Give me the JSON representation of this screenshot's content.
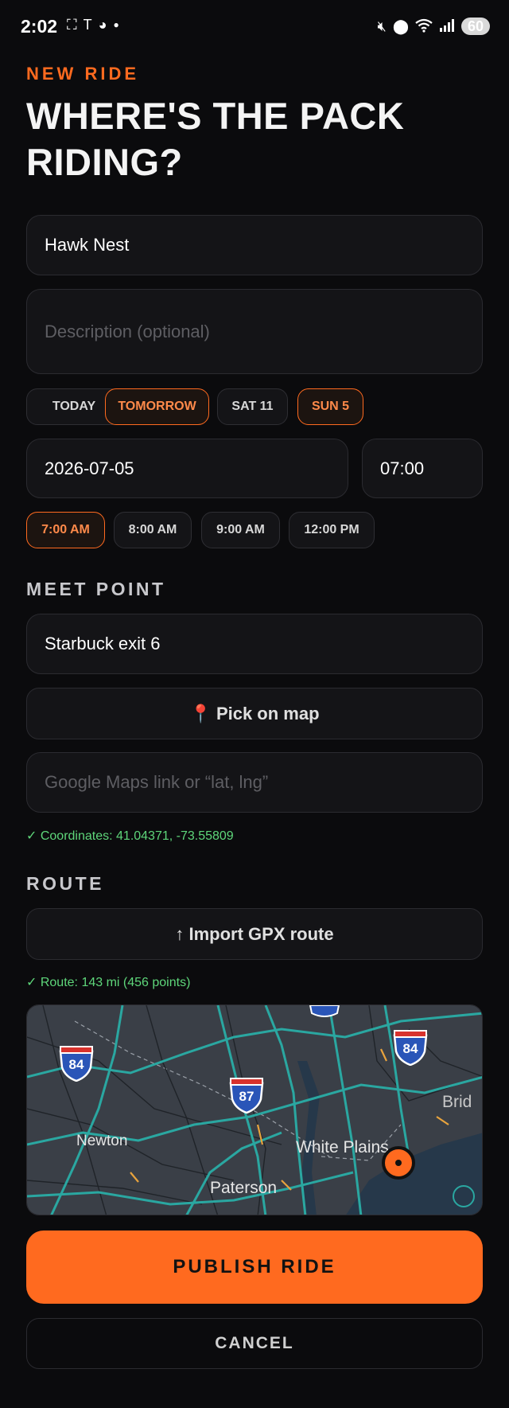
{
  "status_bar": {
    "time": "2:02",
    "left_icons": [
      "screenshot-icon",
      "tesla-icon",
      "reddit-icon",
      "dot-icon"
    ],
    "right_icons": [
      "mute-icon",
      "location-icon",
      "wifi-icon",
      "signal-icon"
    ],
    "battery": "60"
  },
  "header": {
    "eyebrow": "NEW RIDE",
    "title": "WHERE'S THE PACK RIDING?"
  },
  "form": {
    "name_value": "Hawk Nest",
    "description_placeholder": "Description (optional)",
    "date_chips": [
      {
        "label": "TODAY",
        "active": false
      },
      {
        "label": "TOMORROW",
        "active": true
      },
      {
        "label": "SAT 11",
        "active": false
      },
      {
        "label": "SUN 5",
        "active": true
      }
    ],
    "date_value": "2026-07-05",
    "time_value": "07:00",
    "time_chips": [
      {
        "label": "7:00 AM",
        "active": true
      },
      {
        "label": "8:00 AM",
        "active": false
      },
      {
        "label": "9:00 AM",
        "active": false
      },
      {
        "label": "12:00 PM",
        "active": false
      }
    ]
  },
  "meet_point": {
    "label": "MEET POINT",
    "location_value": "Starbuck exit 6",
    "pick_on_map_label": "📍 Pick on map",
    "link_placeholder": "Google Maps link or “lat, lng”",
    "coordinates_text": "✓ Coordinates: 41.04371, -73.55809"
  },
  "route": {
    "label": "ROUTE",
    "import_label": "↑ Import GPX route",
    "route_text": "✓ Route: 143 mi (456 points)"
  },
  "map": {
    "shields": [
      "84",
      "87",
      "84"
    ],
    "places": [
      "Newton",
      "White Plains",
      "Paterson",
      "Brid"
    ]
  },
  "actions": {
    "publish_label": "PUBLISH RIDE",
    "cancel_label": "CANCEL"
  },
  "colors": {
    "accent": "#ff6a1f",
    "background": "#0b0b0d",
    "success": "#5ed67a"
  }
}
